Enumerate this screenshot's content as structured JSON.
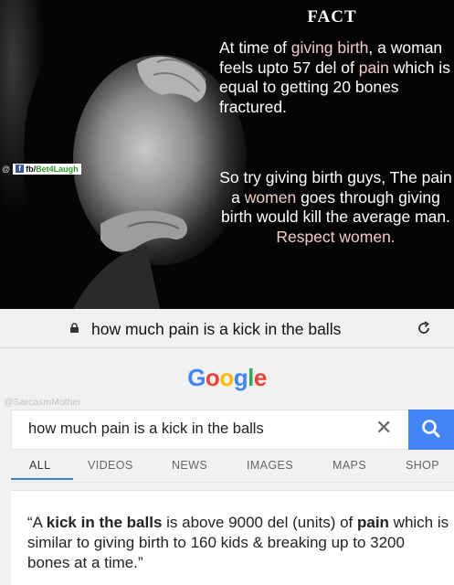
{
  "meme": {
    "heading": "FACT",
    "para1_a": "At time of ",
    "para1_b": "giving birth",
    "para1_c": ", a woman feels upto 57 del of ",
    "para1_d": "pain",
    "para1_e": " which is equal to getting 20 bones fractured.",
    "para2_a": "So try giving birth guys, The pain a ",
    "para2_b": "women",
    "para2_c": " goes through giving birth would kill the average man. ",
    "para2_d": "Respect women.",
    "fb_prefix": "@",
    "fb_handle_a": "fb/",
    "fb_handle_b": "Bet4Laugh"
  },
  "browser": {
    "url": "how much pain is a kick in the balls"
  },
  "google": {
    "logo_letters": [
      "G",
      "o",
      "o",
      "g",
      "l",
      "e"
    ],
    "logo_colors": [
      "#4285f4",
      "#ea4335",
      "#fbbc05",
      "#4285f4",
      "#34a853",
      "#ea4335"
    ],
    "watermark": "@SarcasmMother",
    "query": "how much pain is a kick in the balls",
    "tabs": [
      "ALL",
      "VIDEOS",
      "NEWS",
      "IMAGES",
      "MAPS",
      "SHOP"
    ],
    "active_tab": "ALL",
    "accent": "#4285f4"
  },
  "result": {
    "q1": "“A ",
    "q2": "kick in the balls",
    "q3": " is above 9000 del (units) of ",
    "q4": "pain",
    "q5": " which is similar to giving birth to 160 kids & breaking up to 3200 bones at a time.”"
  }
}
